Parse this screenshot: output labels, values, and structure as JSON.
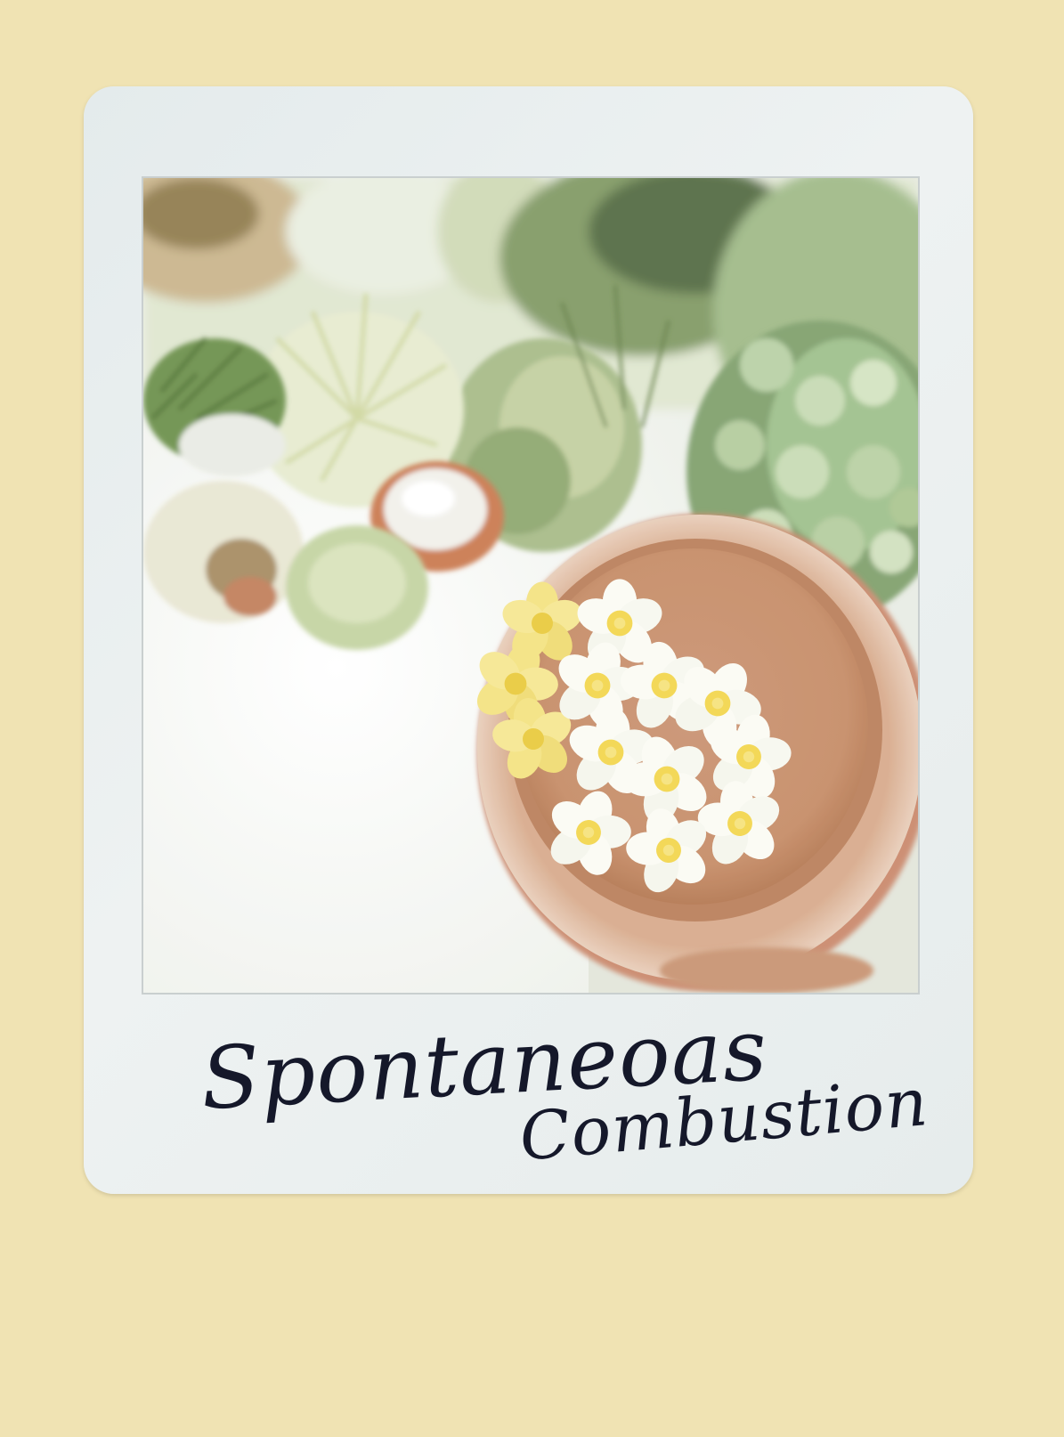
{
  "background_color": "#f0e3b3",
  "polaroid": {
    "frame_color": "#e8eeee",
    "caption": {
      "line1": "Spontaneoas",
      "line2": "Combustion",
      "ink_color": "#15182a"
    }
  },
  "photo": {
    "subject": "terracotta bowl with floating white and yellow plumeria flowers among potted plants",
    "colors": {
      "terracotta": "#c9875c",
      "water": "#c8906a",
      "flower_petal": "#fbfbf4",
      "flower_center": "#f2d54a",
      "yellow_flower": "#f4e07a",
      "foliage_dark": "#6f8f55",
      "foliage_light": "#c8d6a2",
      "ground": "#eef0ea"
    }
  }
}
